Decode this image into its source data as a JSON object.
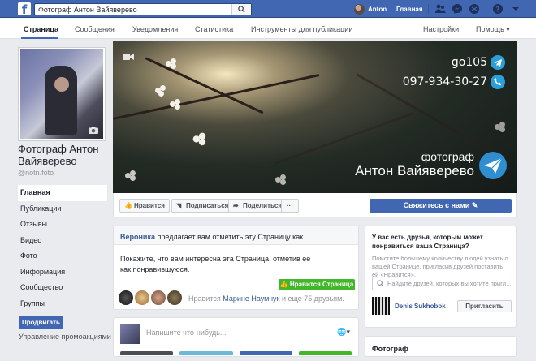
{
  "topbar": {
    "logo": "f",
    "search_value": "Фотограф Антон Вайяверево",
    "user_name": "Anton",
    "home_label": "Главная",
    "icons": [
      "friends-icon",
      "messenger-icon",
      "notifications-icon",
      "help-icon",
      "dropdown-icon"
    ]
  },
  "page_tabs": [
    {
      "label": "Страница",
      "active": true
    },
    {
      "label": "Сообщения"
    },
    {
      "label": "Уведомления"
    },
    {
      "label": "Статистика"
    },
    {
      "label": "Инструменты для публикации"
    },
    {
      "label": "Настройки"
    },
    {
      "label": "Помощь ▾"
    }
  ],
  "profile": {
    "name": "Фотограф Антон Вайяверево",
    "handle": "@notn.foto"
  },
  "sidebar": {
    "items": [
      {
        "label": "Главная",
        "active": true
      },
      {
        "label": "Публикации"
      },
      {
        "label": "Отзывы"
      },
      {
        "label": "Видео"
      },
      {
        "label": "Фото"
      },
      {
        "label": "Информация"
      },
      {
        "label": "Сообщество"
      },
      {
        "label": "Группы"
      }
    ],
    "promote_label": "Продвигать",
    "manage_label": "Управление промоакциями"
  },
  "cover": {
    "phone_handle": "go105",
    "phone_number": "097-934-30-27",
    "brand_line1": "фотограф",
    "brand_line2": "Антон Вайяверево"
  },
  "actions": {
    "like": "Нравится",
    "follow": "Подписаться",
    "share": "Поделиться",
    "more": "···",
    "contact": "Свяжитесь с нами"
  },
  "invite_card": {
    "inviter": "Вероника",
    "title_rest": " предлагает вам отметить эту Страницу как",
    "text": "Покажите, что вам интересна эта Страница, отметив ее как понравившуюся.",
    "like_page_label": "Нравится Страница",
    "likes_prefix": "Нравится ",
    "likes_name": "Марине Наумчук",
    "likes_suffix": " и еще 75 друзьям."
  },
  "composer": {
    "placeholder": "Напишите что-нибудь..."
  },
  "right_card": {
    "title": "У вас есть друзья, которым может понравиться ваша Страница?",
    "text": "Помогите большему количеству людей узнать о вашей Странице, пригласив друзей поставить ей «Нравится».",
    "search_placeholder": "Найдите друзей, которых вы хотите пригл...",
    "friend_name": "Denis Sukhobok",
    "invite_label": "Пригласить"
  },
  "about_card": {
    "title": "Фотограф"
  },
  "colors": {
    "brand_blue": "#4267b2",
    "like_green": "#42b72a",
    "telegram_blue": "#2aa0da"
  }
}
